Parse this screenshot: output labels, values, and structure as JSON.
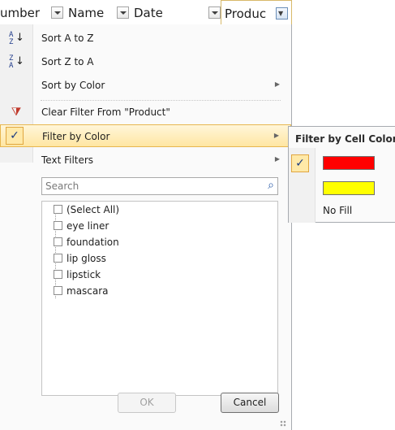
{
  "header": {
    "col1": "umber",
    "col2": "Name",
    "col3": "Date",
    "col4": "Produc"
  },
  "menu": {
    "sort_az": "Sort A to Z",
    "sort_za": "Sort Z to A",
    "sort_by_color": "Sort by Color",
    "clear_filter": "Clear Filter From \"Product\"",
    "filter_by_color": "Filter by Color",
    "text_filters": "Text Filters",
    "sort_az_icon_top": "A",
    "sort_az_icon_bottom": "Z",
    "sort_za_icon_top": "Z",
    "sort_za_icon_bottom": "A",
    "check_mark": "✓"
  },
  "search": {
    "placeholder": "Search"
  },
  "list": {
    "items": [
      "(Select All)",
      "eye liner",
      "foundation",
      "lip gloss",
      "lipstick",
      "mascara"
    ]
  },
  "buttons": {
    "ok": "OK",
    "cancel": "Cancel"
  },
  "submenu": {
    "title": "Filter by Cell Color",
    "no_fill": "No Fill",
    "check_mark": "✓",
    "colors": [
      "#ff0000",
      "#ffff00"
    ]
  },
  "colors": {
    "highlight_border": "#e7b64f",
    "highlight_bg": "#ffe6a3"
  }
}
